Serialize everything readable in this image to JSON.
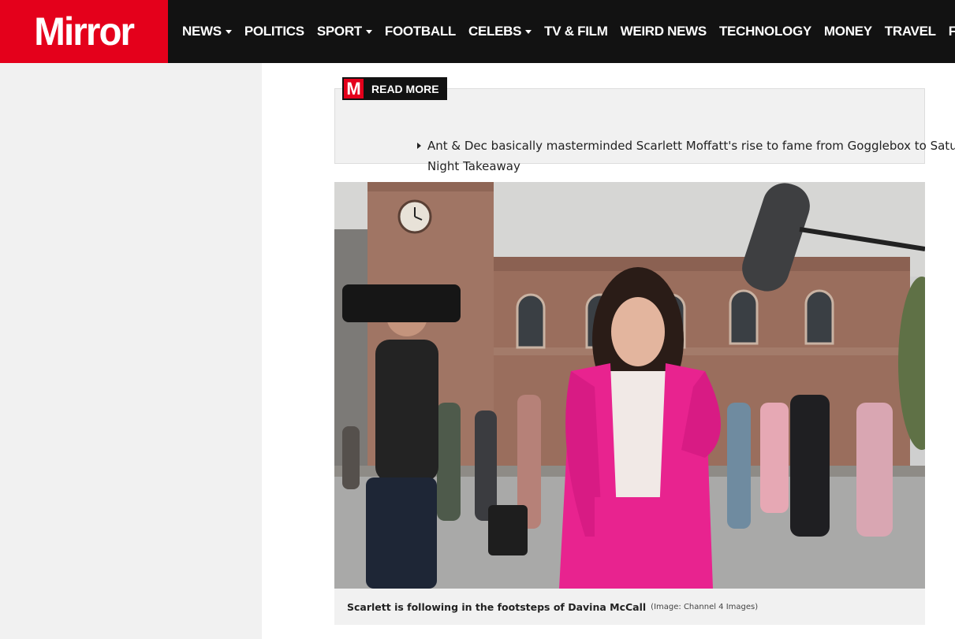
{
  "header": {
    "logo_text": "Mirror",
    "nav": [
      {
        "label": "NEWS",
        "dropdown": true
      },
      {
        "label": "POLITICS",
        "dropdown": false
      },
      {
        "label": "SPORT",
        "dropdown": true
      },
      {
        "label": "FOOTBALL",
        "dropdown": false
      },
      {
        "label": "CELEBS",
        "dropdown": true
      },
      {
        "label": "TV & FILM",
        "dropdown": false
      },
      {
        "label": "WEIRD NEWS",
        "dropdown": false
      },
      {
        "label": "TECHNOLOGY",
        "dropdown": false
      },
      {
        "label": "MONEY",
        "dropdown": false
      },
      {
        "label": "TRAVEL",
        "dropdown": false
      },
      {
        "label": "FASHION",
        "dropdown": false
      }
    ]
  },
  "read_more": {
    "badge": "M",
    "label": "READ MORE",
    "link_text": "Ant & Dec basically masterminded Scarlett Moffatt's rise to fame from Gogglebox to Saturday Night Takeaway"
  },
  "image": {
    "caption": "Scarlett is following in the footsteps of Davina McCall",
    "credit": "(Image: Channel 4 Images)",
    "clock_icon": "clock-icon"
  },
  "colors": {
    "brand_red": "#e4001b",
    "nav_bg": "#121212",
    "page_grey": "#f1f1f1",
    "jacket_pink": "#e8238f"
  }
}
